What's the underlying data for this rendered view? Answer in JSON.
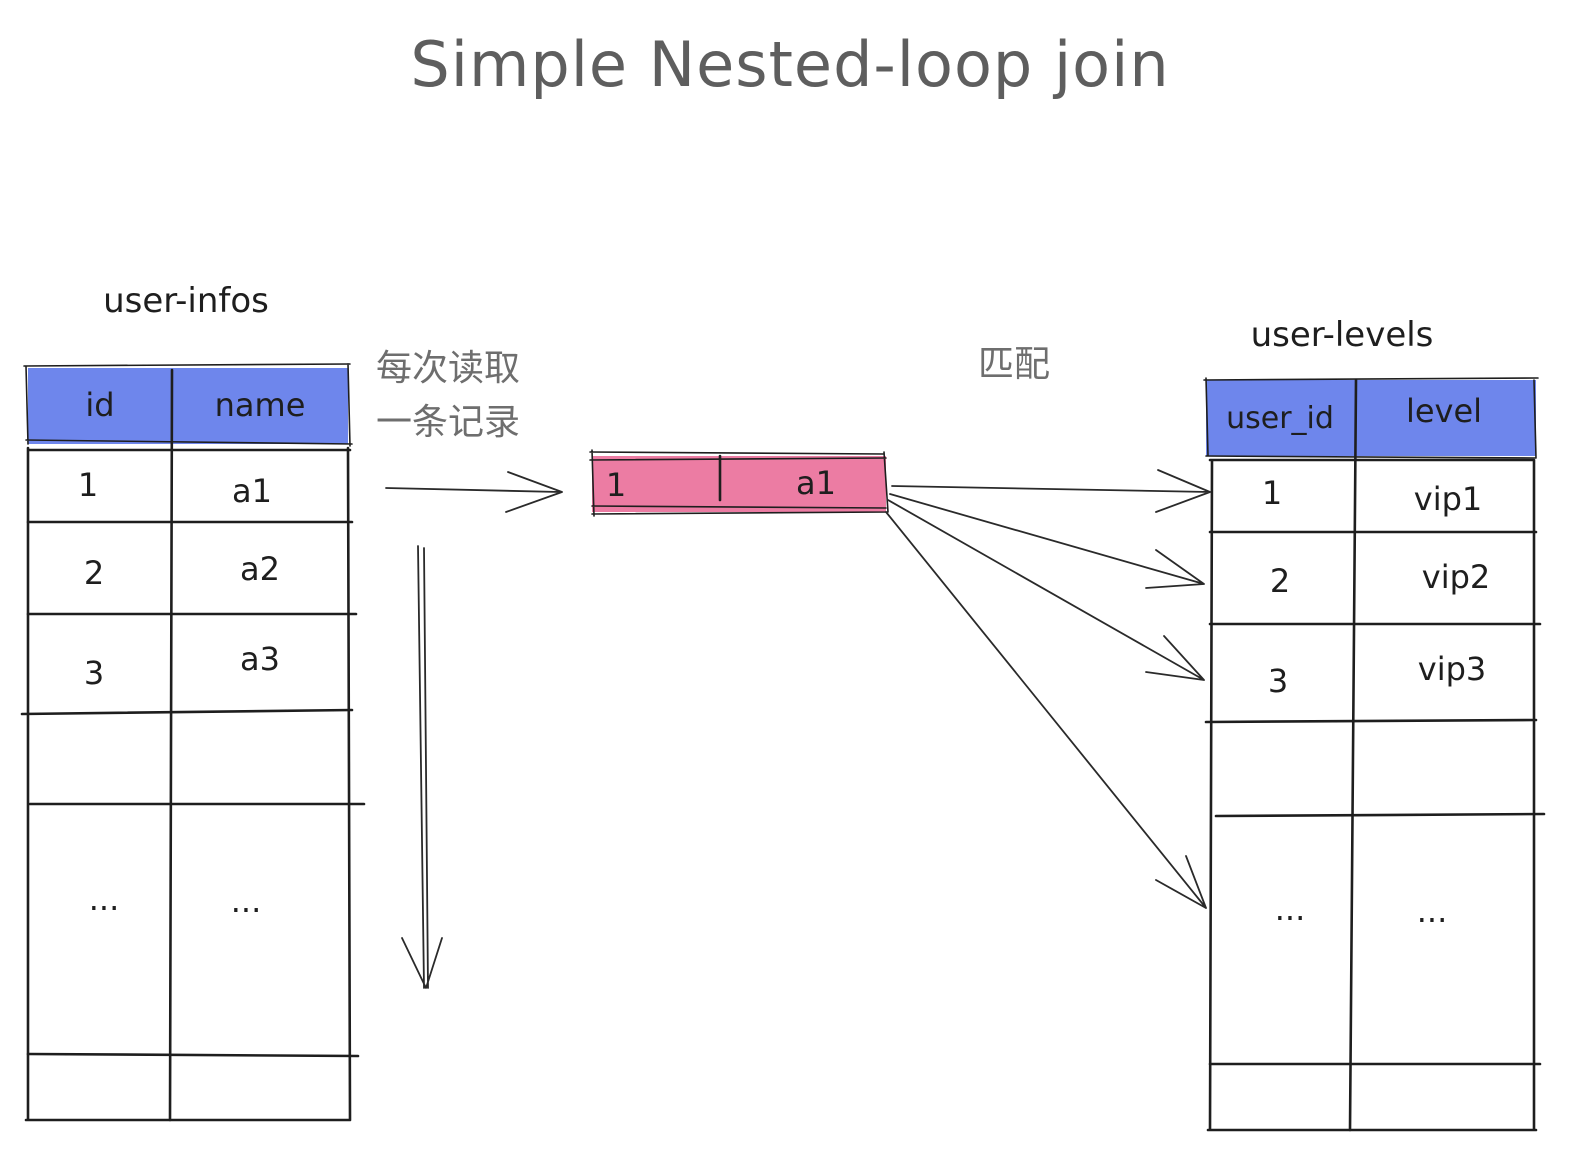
{
  "title": "Simple Nested-loop join",
  "left_table": {
    "label": "user-infos",
    "headers": [
      "id",
      "name"
    ],
    "rows": [
      [
        "1",
        "a1"
      ],
      [
        "2",
        "a2"
      ],
      [
        "3",
        "a3"
      ],
      [
        "",
        ""
      ],
      [
        "...",
        "..."
      ],
      [
        "",
        ""
      ]
    ]
  },
  "right_table": {
    "label": "user-levels",
    "headers": [
      "user_id",
      "level"
    ],
    "rows": [
      [
        "1",
        "vip1"
      ],
      [
        "2",
        "vip2"
      ],
      [
        "3",
        "vip3"
      ],
      [
        "",
        ""
      ],
      [
        "...",
        "..."
      ],
      [
        "",
        ""
      ]
    ]
  },
  "current_record": {
    "id": "1",
    "name": "a1"
  },
  "notes": {
    "read_line1": "每次读取",
    "read_line2": "一条记录",
    "match": "匹配"
  },
  "colors": {
    "header_fill": "#6e86ec",
    "record_fill": "#ec7ca3",
    "stroke": "#1e1e1e",
    "title_text": "#5e5e5e",
    "note_text": "#6e6e6e"
  }
}
